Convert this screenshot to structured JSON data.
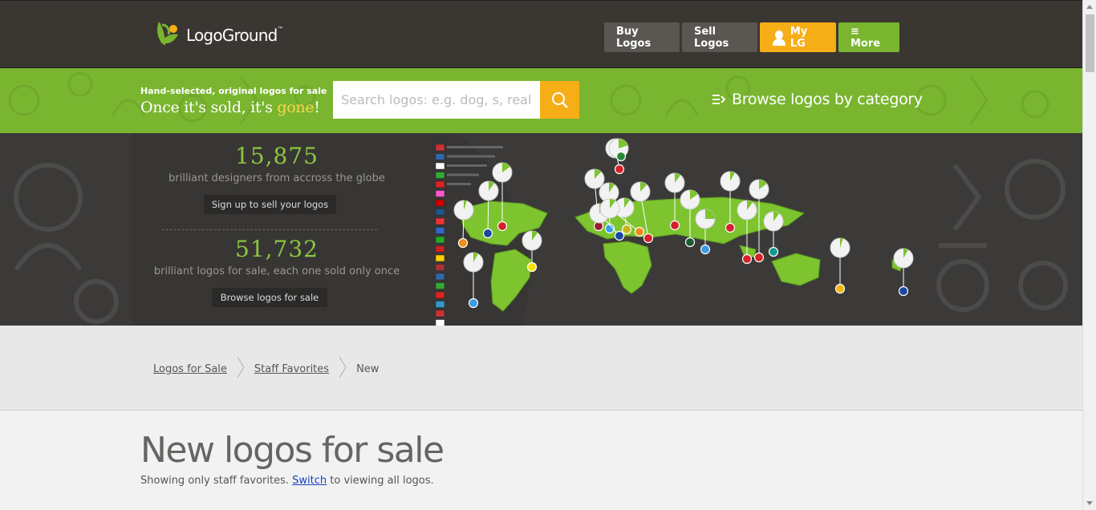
{
  "header": {
    "logo_text": "LogoGround",
    "logo_tm": "™",
    "nav": {
      "buy": "Buy Logos",
      "sell": "Sell Logos",
      "mylg": "My LG",
      "more": "≡ More"
    }
  },
  "promo": {
    "tagline_small": "Hand-selected, original logos for sale",
    "tagline_main": "Once it's sold, it's ",
    "tagline_highlight": "gone",
    "tagline_end": "!",
    "search_placeholder": "Search logos: e.g. dog, s, real estate",
    "browse_category": "Browse logos by category"
  },
  "stats": {
    "designers_count": "15,875",
    "designers_desc": "brilliant designers from accross the globe",
    "designers_button": "Sign up to sell your logos",
    "logos_count": "51,732",
    "logos_desc": "brilliant logos for sale, each one sold only once",
    "logos_button": "Browse logos for sale"
  },
  "breadcrumb": {
    "items": [
      "Logos for Sale",
      "Staff Favorites"
    ],
    "current": "New"
  },
  "main": {
    "title": "New logos for sale",
    "subtitle_before": "Showing only staff favorites.",
    "subtitle_link": "Switch",
    "subtitle_after": "to viewing all logos."
  },
  "colors": {
    "brand_green": "#79b52f",
    "brand_orange": "#f6ae17",
    "header_dark": "#3a3632"
  },
  "map_pins": [
    {
      "color": "#f08c1a",
      "fill": 0.05
    },
    {
      "color": "#1a47a0",
      "fill": 0.1
    },
    {
      "color": "#d4212a",
      "fill": 0.15
    },
    {
      "color": "#3a9ce0",
      "fill": 0.08
    },
    {
      "color": "#f5e20a",
      "fill": 0.1
    },
    {
      "color": "#9c1c32",
      "fill": 0.12
    },
    {
      "color": "#d4212a",
      "fill": 0.1
    },
    {
      "color": "#3a9ce0",
      "fill": 0.1
    },
    {
      "color": "#1a47a0",
      "fill": 0.12
    },
    {
      "color": "#c5b51c",
      "fill": 0.1
    },
    {
      "color": "#f08c1a",
      "fill": 0.1
    },
    {
      "color": "#d4212a",
      "fill": 0.12
    },
    {
      "color": "#2a8a3c",
      "fill": 0.2
    },
    {
      "color": "#d4212a",
      "fill": 0.1
    },
    {
      "color": "#1d5c33",
      "fill": 0.15
    },
    {
      "color": "#3a9ce0",
      "fill": 0.25
    },
    {
      "color": "#d4212a",
      "fill": 0.08
    },
    {
      "color": "#d4212a",
      "fill": 0.1
    },
    {
      "color": "#d4212a",
      "fill": 0.15
    },
    {
      "color": "#199a8c",
      "fill": 0.1
    },
    {
      "color": "#f5b50a",
      "fill": 0.05
    },
    {
      "color": "#1a47a0",
      "fill": 0.08
    }
  ]
}
